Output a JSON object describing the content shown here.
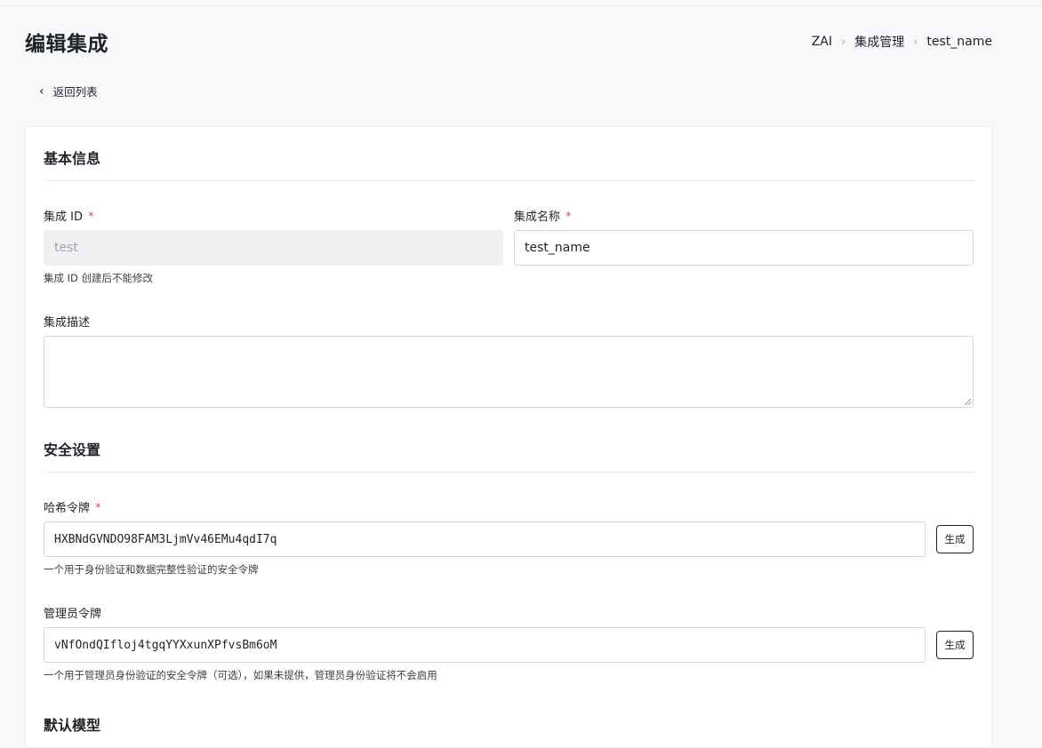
{
  "header": {
    "title": "编辑集成",
    "breadcrumb": [
      "ZAI",
      "集成管理",
      "test_name"
    ]
  },
  "back_link": {
    "icon": "chevron-left-icon",
    "label": "返回列表"
  },
  "basic_info": {
    "title": "基本信息",
    "integration_id": {
      "label": "集成 ID",
      "required_mark": "*",
      "value": "test",
      "hint": "集成 ID 创建后不能修改"
    },
    "integration_name": {
      "label": "集成名称",
      "required_mark": "*",
      "value": "test_name"
    },
    "description": {
      "label": "集成描述",
      "value": ""
    }
  },
  "security": {
    "title": "安全设置",
    "hash_token": {
      "label": "哈希令牌",
      "required_mark": "*",
      "value": "HXBNdGVNDO98FAM3LjmVv46EMu4qdI7q",
      "button": "生成",
      "hint": "一个用于身份验证和数据完整性验证的安全令牌"
    },
    "admin_token": {
      "label": "管理员令牌",
      "value": "vNfOndQIfloj4tgqYYXxunXPfvsBm6oM",
      "button": "生成",
      "hint": "一个用于管理员身份验证的安全令牌（可选），如果未提供，管理员身份验证将不会启用"
    }
  },
  "default_model": {
    "title": "默认模型"
  }
}
